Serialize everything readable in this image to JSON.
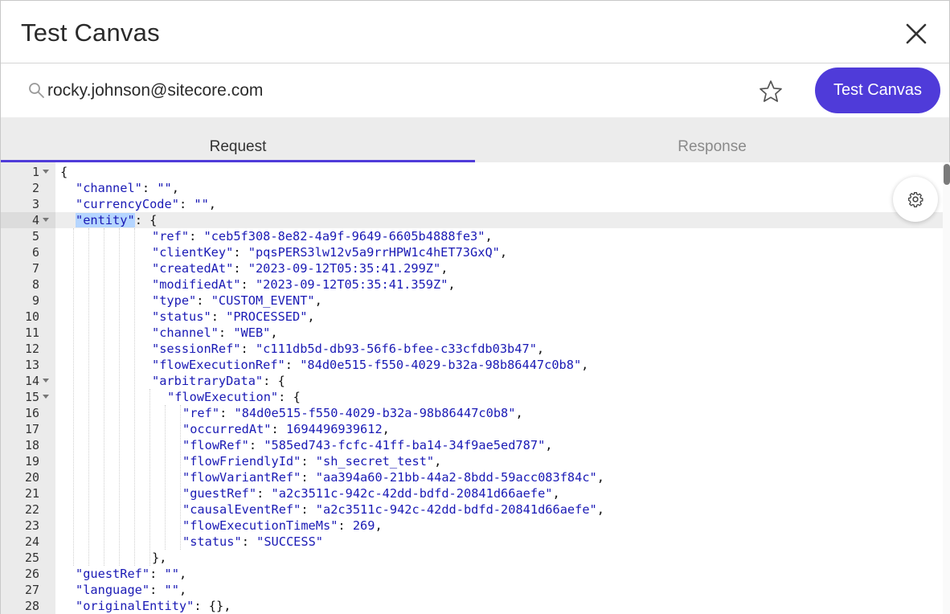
{
  "dialog": {
    "title": "Test Canvas"
  },
  "search": {
    "value": "rocky.johnson@sitecore.com"
  },
  "actions": {
    "test_label": "Test Canvas"
  },
  "tabs": [
    {
      "label": "Request",
      "active": true
    },
    {
      "label": "Response",
      "active": false
    }
  ],
  "colors": {
    "accent": "#4f3bd9",
    "code_string": "#1a1ab5"
  },
  "icons": {
    "search": "search-icon",
    "star": "star-icon",
    "close": "close-icon",
    "settings": "gear-icon"
  },
  "code_lines": [
    {
      "n": "1",
      "fold": true,
      "indent": 0,
      "text": "{"
    },
    {
      "n": "2",
      "fold": false,
      "indent": 1,
      "text": "\"channel\": \"\","
    },
    {
      "n": "3",
      "fold": false,
      "indent": 1,
      "text": "\"currencyCode\": \"\","
    },
    {
      "n": "4",
      "fold": true,
      "indent": 1,
      "text": "\"entity\": {",
      "active": true
    },
    {
      "n": "5",
      "fold": false,
      "indent": 6,
      "text": "\"ref\": \"ceb5f308-8e82-4a9f-9649-6605b4888fe3\","
    },
    {
      "n": "6",
      "fold": false,
      "indent": 6,
      "text": "\"clientKey\": \"pqsPERS3lw12v5a9rrHPW1c4hET73GxQ\","
    },
    {
      "n": "7",
      "fold": false,
      "indent": 6,
      "text": "\"createdAt\": \"2023-09-12T05:35:41.299Z\","
    },
    {
      "n": "8",
      "fold": false,
      "indent": 6,
      "text": "\"modifiedAt\": \"2023-09-12T05:35:41.359Z\","
    },
    {
      "n": "9",
      "fold": false,
      "indent": 6,
      "text": "\"type\": \"CUSTOM_EVENT\","
    },
    {
      "n": "10",
      "fold": false,
      "indent": 6,
      "text": "\"status\": \"PROCESSED\","
    },
    {
      "n": "11",
      "fold": false,
      "indent": 6,
      "text": "\"channel\": \"WEB\","
    },
    {
      "n": "12",
      "fold": false,
      "indent": 6,
      "text": "\"sessionRef\": \"c111db5d-db93-56f6-bfee-c33cfdb03b47\","
    },
    {
      "n": "13",
      "fold": false,
      "indent": 6,
      "text": "\"flowExecutionRef\": \"84d0e515-f550-4029-b32a-98b86447c0b8\","
    },
    {
      "n": "14",
      "fold": true,
      "indent": 6,
      "text": "\"arbitraryData\": {"
    },
    {
      "n": "15",
      "fold": true,
      "indent": 7,
      "text": "\"flowExecution\": {"
    },
    {
      "n": "16",
      "fold": false,
      "indent": 8,
      "text": "\"ref\": \"84d0e515-f550-4029-b32a-98b86447c0b8\","
    },
    {
      "n": "17",
      "fold": false,
      "indent": 8,
      "text": "\"occurredAt\": 1694496939612,"
    },
    {
      "n": "18",
      "fold": false,
      "indent": 8,
      "text": "\"flowRef\": \"585ed743-fcfc-41ff-ba14-34f9ae5ed787\","
    },
    {
      "n": "19",
      "fold": false,
      "indent": 8,
      "text": "\"flowFriendlyId\": \"sh_secret_test\","
    },
    {
      "n": "20",
      "fold": false,
      "indent": 8,
      "text": "\"flowVariantRef\": \"aa394a60-21bb-44a2-8bdd-59acc083f84c\","
    },
    {
      "n": "21",
      "fold": false,
      "indent": 8,
      "text": "\"guestRef\": \"a2c3511c-942c-42dd-bdfd-20841d66aefe\","
    },
    {
      "n": "22",
      "fold": false,
      "indent": 8,
      "text": "\"causalEventRef\": \"a2c3511c-942c-42dd-bdfd-20841d66aefe\","
    },
    {
      "n": "23",
      "fold": false,
      "indent": 8,
      "text": "\"flowExecutionTimeMs\": 269,"
    },
    {
      "n": "24",
      "fold": false,
      "indent": 8,
      "text": "\"status\": \"SUCCESS\""
    },
    {
      "n": "25",
      "fold": false,
      "indent": 6,
      "text": "},"
    },
    {
      "n": "26",
      "fold": false,
      "indent": 1,
      "text": "\"guestRef\": \"\","
    },
    {
      "n": "27",
      "fold": false,
      "indent": 1,
      "text": "\"language\": \"\","
    },
    {
      "n": "28",
      "fold": false,
      "indent": 1,
      "text": "\"originalEntity\": {},"
    }
  ]
}
